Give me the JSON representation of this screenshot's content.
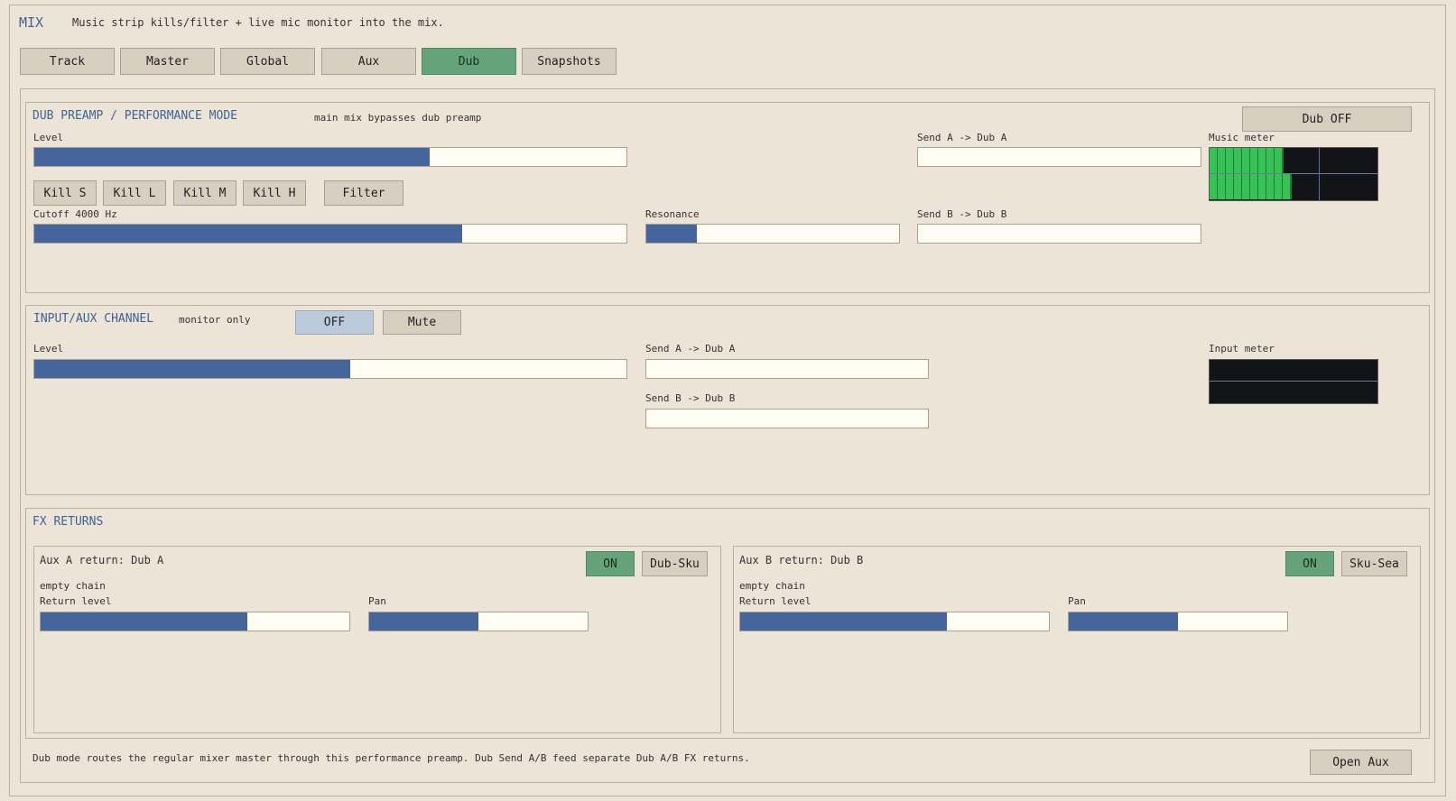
{
  "header": {
    "title": "MIX",
    "subtitle": "Music strip kills/filter + live mic monitor into the mix."
  },
  "tabs": [
    {
      "label": "Track",
      "active": false
    },
    {
      "label": "Master",
      "active": false
    },
    {
      "label": "Global",
      "active": false
    },
    {
      "label": "Aux",
      "active": false
    },
    {
      "label": "Dub",
      "active": true
    },
    {
      "label": "Snapshots",
      "active": false
    }
  ],
  "dub_preamp": {
    "title": "DUB PREAMP / PERFORMANCE MODE",
    "note": "main mix bypasses dub preamp",
    "dub_toggle_label": "Dub OFF",
    "level_label": "Level",
    "level_value": 0.667,
    "kill_buttons": [
      "Kill S",
      "Kill L",
      "Kill M",
      "Kill H"
    ],
    "filter_label": "Filter",
    "cutoff_label": "Cutoff 4000 Hz",
    "cutoff_value": 0.722,
    "resonance_label": "Resonance",
    "resonance_value": 0.2,
    "send_a_label": "Send A -> Dub A",
    "send_a_value": 0,
    "send_b_label": "Send B -> Dub B",
    "send_b_value": 0,
    "meter_label": "Music meter",
    "meter_levels": [
      0.44,
      0.49
    ],
    "meter_peak": 0.65
  },
  "input_aux": {
    "title": "INPUT/AUX CHANNEL",
    "note": "monitor only",
    "off_label": "OFF",
    "mute_label": "Mute",
    "level_label": "Level",
    "level_value": 0.533,
    "send_a_label": "Send A -> Dub A",
    "send_a_value": 0,
    "send_b_label": "Send B -> Dub B",
    "send_b_value": 0,
    "meter_label": "Input meter",
    "meter_levels": [
      0,
      0
    ]
  },
  "fx_returns": {
    "title": "FX RETURNS",
    "returns": [
      {
        "title": "Aux A return: Dub A",
        "on_label": "ON",
        "preset_label": "Dub-Sku",
        "chain": "empty chain",
        "return_label": "Return level",
        "return_value": 0.67,
        "pan_label": "Pan",
        "pan_value": 0.5
      },
      {
        "title": "Aux B return: Dub B",
        "on_label": "ON",
        "preset_label": "Sku-Sea",
        "chain": "empty chain",
        "return_label": "Return level",
        "return_value": 0.67,
        "pan_label": "Pan",
        "pan_value": 0.5
      }
    ]
  },
  "footer": {
    "text": "Dub mode routes the regular mixer master through this performance preamp. Dub Send A/B feed separate Dub A/B FX returns.",
    "open_aux_label": "Open Aux"
  },
  "colors": {
    "background": "#ece4d6",
    "accent_blue": "#3f6496",
    "slider_fill": "#44669c",
    "active_green": "#65a37b",
    "meter_green": "#37c257",
    "meter_bg": "#121418"
  }
}
